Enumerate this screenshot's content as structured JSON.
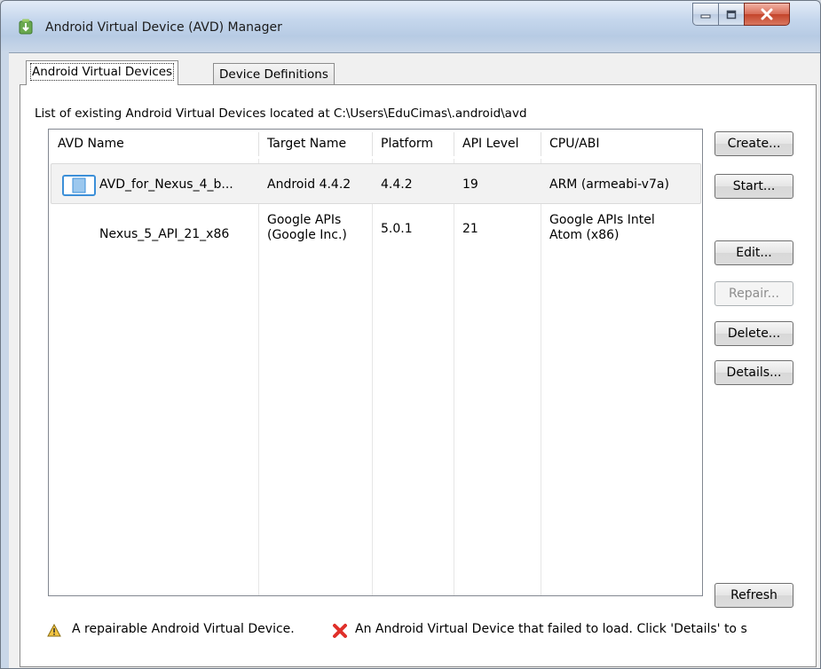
{
  "window": {
    "title": "Android Virtual Device (AVD) Manager"
  },
  "tabs": [
    {
      "label": "Android Virtual Devices",
      "active": true
    },
    {
      "label": "Device Definitions",
      "active": false
    }
  ],
  "list_label": "List of existing Android Virtual Devices located at C:\\Users\\EduCimas\\.android\\avd",
  "table": {
    "columns": [
      "AVD Name",
      "Target Name",
      "Platform",
      "API Level",
      "CPU/ABI"
    ],
    "rows": [
      {
        "name": "AVD_for_Nexus_4_b...",
        "target": "Android 4.4.2",
        "platform": "4.4.2",
        "api": "19",
        "cpu": "ARM (armeabi-v7a)",
        "selected": true
      },
      {
        "name": "Nexus_5_API_21_x86",
        "target": "Google APIs (Google Inc.)",
        "target_line1": "Google APIs",
        "target_line2": "(Google Inc.)",
        "platform": "5.0.1",
        "api": "21",
        "cpu": "Google APIs Intel Atom (x86)",
        "cpu_line1": "Google APIs Intel",
        "cpu_line2": "Atom (x86)",
        "selected": false
      }
    ]
  },
  "buttons": {
    "create": "Create...",
    "start": "Start...",
    "edit": "Edit...",
    "repair": "Repair...",
    "delete": "Delete...",
    "details": "Details...",
    "refresh": "Refresh"
  },
  "legend": {
    "repairable": "A repairable Android Virtual Device.",
    "failed": "An Android Virtual Device that failed to load. Click 'Details' to s"
  },
  "icons": {
    "app": "android-download-icon",
    "device": "tablet-device-icon",
    "warning": "warning-triangle-icon",
    "failed": "red-x-icon"
  },
  "colors": {
    "titlebar": "#c4d6ec",
    "close_button": "#c4442b",
    "disabled_text": "#8d8d8d",
    "row_selected": "#f2f2f2"
  }
}
